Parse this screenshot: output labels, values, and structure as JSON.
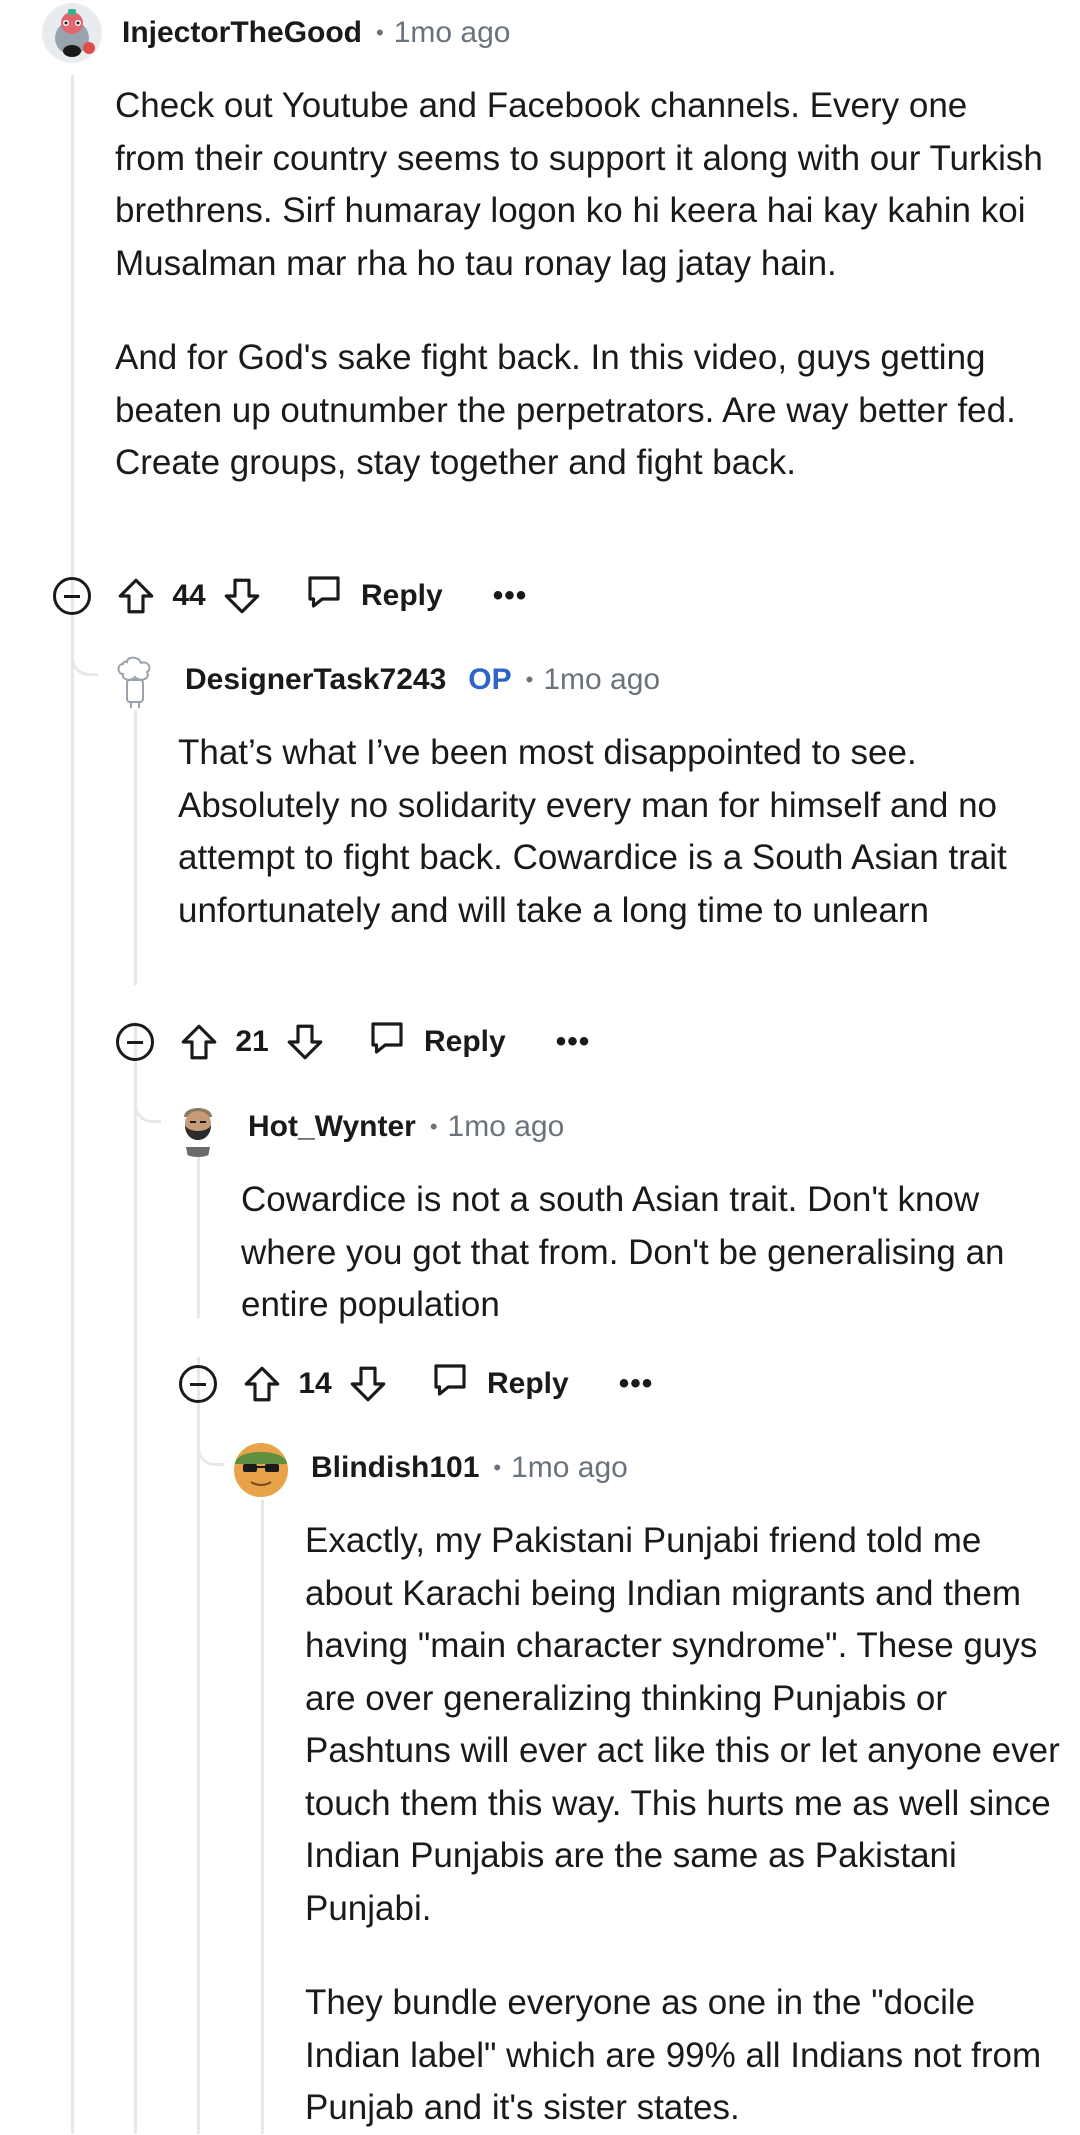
{
  "comments": [
    {
      "username": "InjectorTheGood",
      "op": "",
      "time": "1mo ago",
      "paragraphs": [
        "Check out Youtube and Facebook channels. Every one from their country seems to support it along with our Turkish brethrens. Sirf humaray logon ko hi keera hai kay kahin koi Musalman mar rha ho tau ronay lag jatay hain.",
        "And for God's sake fight back. In this video, guys getting beaten up outnumber the perpetrators. Are way better fed. Create groups, stay together and fight back."
      ],
      "score": "44",
      "reply_label": "Reply",
      "more_label": "•••"
    },
    {
      "username": "DesignerTask7243",
      "op": "OP",
      "time": "1mo ago",
      "paragraphs": [
        "That’s what I’ve been most disappointed to see. Absolutely no solidarity every man for himself and no attempt to fight back. Cowardice is a South Asian trait unfortunately and will take a long time to unlearn"
      ],
      "score": "21",
      "reply_label": "Reply",
      "more_label": "•••"
    },
    {
      "username": "Hot_Wynter",
      "op": "",
      "time": "1mo ago",
      "paragraphs": [
        "Cowardice is not a south Asian trait. Don't know where you got that from. Don't be generalising an entire population"
      ],
      "score": "14",
      "reply_label": "Reply",
      "more_label": "•••"
    },
    {
      "username": "Blindish101",
      "op": "",
      "time": "1mo ago",
      "paragraphs": [
        "Exactly, my Pakistani Punjabi friend told me about Karachi being Indian migrants and them having \"main character syndrome\". These guys are over generalizing thinking Punjabis or Pashtuns will ever act like this or let anyone ever touch them this way. This hurts me as well since Indian Punjabis are the same as Pakistani Punjabi.",
        "They bundle everyone as one in the \"docile Indian label\" which are 99% all Indians not from Punjab and it's sister states."
      ]
    }
  ],
  "colors": {
    "text": "#1a1a1b",
    "meta": "#6a737c",
    "op_badge": "#2f64c7",
    "thread_line": "#e5e7ea"
  }
}
